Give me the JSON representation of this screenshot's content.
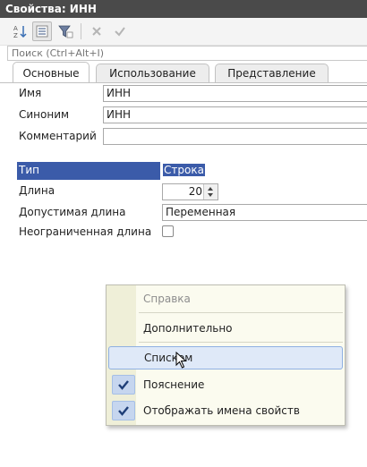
{
  "window": {
    "title": "Свойства: ИНН"
  },
  "toolbar": {
    "buttons": [
      {
        "name": "sort-az-icon",
        "enabled": true
      },
      {
        "name": "category-view-icon",
        "enabled": true,
        "pressed": true
      },
      {
        "name": "filter-icon",
        "enabled": true
      },
      {
        "name": "close-icon",
        "enabled": false
      },
      {
        "name": "check-icon",
        "enabled": false
      }
    ]
  },
  "search": {
    "placeholder": "Поиск (Ctrl+Alt+I)"
  },
  "tabs": [
    {
      "label": "Основные",
      "active": true
    },
    {
      "label": "Использование",
      "active": false
    },
    {
      "label": "Представление",
      "active": false
    }
  ],
  "fields": {
    "name": {
      "label": "Имя",
      "value": "ИНН"
    },
    "synonym": {
      "label": "Синоним",
      "value": "ИНН"
    },
    "comment": {
      "label": "Комментарий",
      "value": ""
    },
    "type": {
      "label": "Тип",
      "value": "Строка"
    },
    "length": {
      "label": "Длина",
      "value": "20"
    },
    "allowed_length": {
      "label": "Допустимая длина",
      "value": "Переменная"
    },
    "unlimited_length": {
      "label": "Неограниченная длина",
      "checked": false
    }
  },
  "context_menu": {
    "items": [
      {
        "label": "Справка",
        "enabled": false,
        "checked": false
      },
      {
        "label": "Дополнительно",
        "enabled": true,
        "checked": false
      },
      {
        "label": "Списком",
        "enabled": true,
        "checked": false,
        "hovered": true
      },
      {
        "label": "Пояснение",
        "enabled": true,
        "checked": true
      },
      {
        "label": "Отображать имена свойств",
        "enabled": true,
        "checked": true
      }
    ]
  },
  "colors": {
    "selection": "#3b5ba9",
    "menu_background": "#fbfbef",
    "menu_hover": "#dfe9f8",
    "title_bar": "#4a4a4a"
  }
}
